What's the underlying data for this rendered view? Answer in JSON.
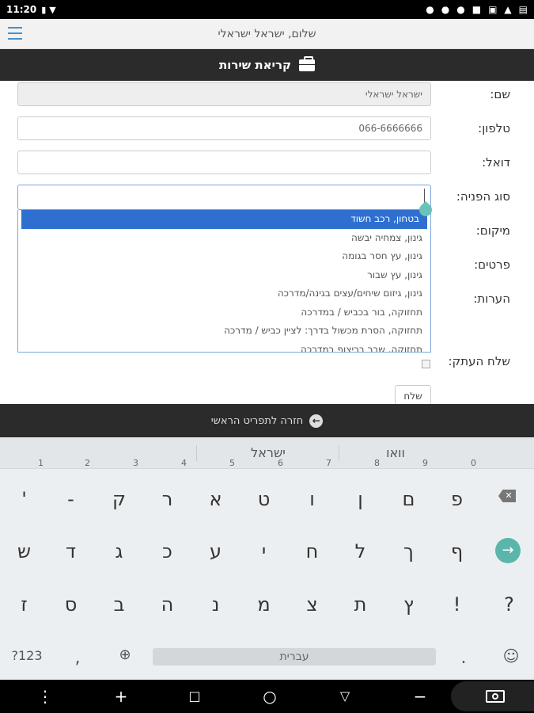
{
  "status_bar": {
    "time": "11:20"
  },
  "header": {
    "greeting": "שלום, ישראל ישראלי"
  },
  "title_bar": {
    "title": "קריאת שירות"
  },
  "form": {
    "labels": {
      "name": "שם:",
      "phone": "טלפון:",
      "email": "דואל:",
      "request_type": "סוג הפניה:",
      "location": "מיקום:",
      "details": "פרטים:",
      "notes": "הערות:",
      "send_copy": "שלח העתק:"
    },
    "name_value": "ישראל ישראלי",
    "phone_value": "066-6666666",
    "email_value": "",
    "request_type_options": [
      "בטחון, רכב חשוד",
      "גינון, צמחיה יבשה",
      "גינון, עץ חסר בגומה",
      "גינון, עץ שבור",
      "גינון, גיזום שיחים/עצים בגינה/מדרכה",
      "תחזוקה, בור בכביש / במדרכה",
      "תחזוקה, הסרת מכשול בדרך: לציין כביש / מדרכה",
      "תחזוקה, שבר בריצוף במדרכה"
    ],
    "send_label": "שלח"
  },
  "back_bar": {
    "label": "חזרה לתפריט הראשי"
  },
  "keyboard": {
    "suggestions": [
      "וואו",
      "ישראל"
    ],
    "row1": [
      "פ",
      "ם",
      "ן",
      "ו",
      "ט",
      "א",
      "ר",
      "ק",
      "-",
      "'"
    ],
    "row1_hints": [
      "0",
      "9",
      "8",
      "7",
      "6",
      "5",
      "4",
      "3",
      "2",
      "1"
    ],
    "row2": [
      "ף",
      "ך",
      "ל",
      "ח",
      "י",
      "ע",
      "כ",
      "ג",
      "ד",
      "ש"
    ],
    "row3": [
      "?",
      "!",
      "ץ",
      "ת",
      "צ",
      "מ",
      "נ",
      "ה",
      "ב",
      "ס",
      "ז"
    ],
    "symbols_key": "?123",
    "comma_key": ",",
    "space_label": "עברית",
    "period_key": "."
  }
}
